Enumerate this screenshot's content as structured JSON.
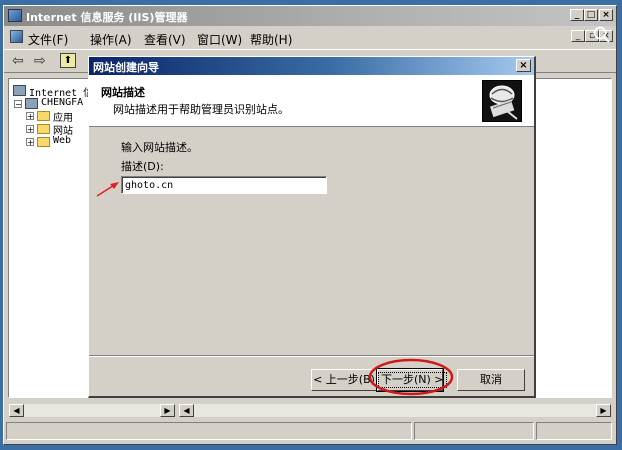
{
  "window": {
    "title": "Internet 信息服务 (IIS)管理器",
    "controls": [
      "_",
      "□",
      "×"
    ]
  },
  "menubar": {
    "items": [
      "文件(F)",
      "操作(A)",
      "查看(V)",
      "窗口(W)",
      "帮助(H)"
    ]
  },
  "toolbar": {
    "back_glyph": "⇦",
    "forward_glyph": "⇨",
    "up_glyph": "⬆"
  },
  "tree": {
    "nodes": [
      {
        "label": "Internet 信",
        "level": 0
      },
      {
        "label": "CHENGFA",
        "level": 1
      },
      {
        "label": "应用",
        "level": 2
      },
      {
        "label": "网站",
        "level": 2
      },
      {
        "label": "Web",
        "level": 2
      }
    ]
  },
  "dialog": {
    "title": "网站创建向导",
    "close_glyph": "×",
    "header_title": "网站描述",
    "header_subtitle": "网站描述用于帮助管理员识别站点。",
    "instruction": "输入网站描述。",
    "field_label": "描述(D):",
    "field_value": "ghoto.cn",
    "buttons": {
      "back": "< 上一步(B)",
      "next": "下一步(N) >",
      "cancel": "取消"
    }
  },
  "colors": {
    "dialog_title_start": "#0a246a",
    "dialog_title_end": "#a6caf0",
    "annotation": "#e02020",
    "desktop": "#3a6ea5"
  }
}
